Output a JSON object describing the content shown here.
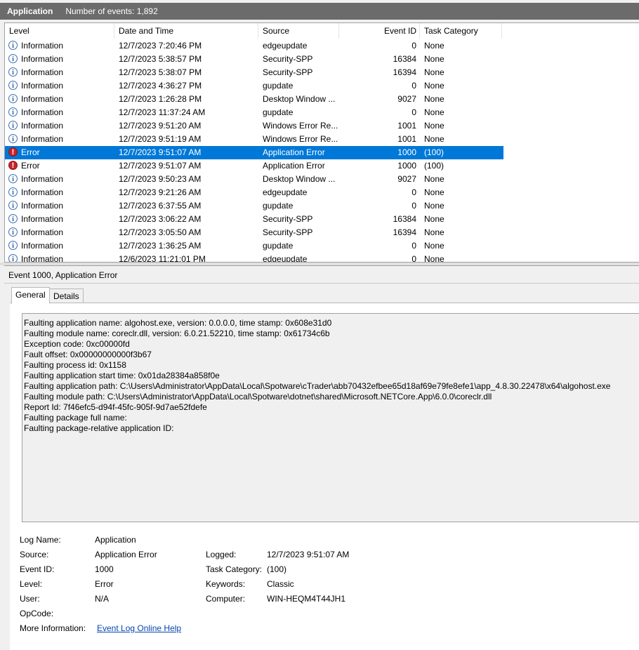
{
  "titlebar": {
    "log": "Application",
    "count": "Number of events: 1,892"
  },
  "columns": [
    "Level",
    "Date and Time",
    "Source",
    "Event ID",
    "Task Category"
  ],
  "events": [
    {
      "level": "Information",
      "icon": "info",
      "date": "12/7/2023 7:20:46 PM",
      "source": "edgeupdate",
      "id": "0",
      "cat": "None"
    },
    {
      "level": "Information",
      "icon": "info",
      "date": "12/7/2023 5:38:57 PM",
      "source": "Security-SPP",
      "id": "16384",
      "cat": "None"
    },
    {
      "level": "Information",
      "icon": "info",
      "date": "12/7/2023 5:38:07 PM",
      "source": "Security-SPP",
      "id": "16394",
      "cat": "None"
    },
    {
      "level": "Information",
      "icon": "info",
      "date": "12/7/2023 4:36:27 PM",
      "source": "gupdate",
      "id": "0",
      "cat": "None"
    },
    {
      "level": "Information",
      "icon": "info",
      "date": "12/7/2023 1:26:28 PM",
      "source": "Desktop Window ...",
      "id": "9027",
      "cat": "None"
    },
    {
      "level": "Information",
      "icon": "info",
      "date": "12/7/2023 11:37:24 AM",
      "source": "gupdate",
      "id": "0",
      "cat": "None"
    },
    {
      "level": "Information",
      "icon": "info",
      "date": "12/7/2023 9:51:20 AM",
      "source": "Windows Error Re...",
      "id": "1001",
      "cat": "None"
    },
    {
      "level": "Information",
      "icon": "info",
      "date": "12/7/2023 9:51:19 AM",
      "source": "Windows Error Re...",
      "id": "1001",
      "cat": "None"
    },
    {
      "level": "Error",
      "icon": "err",
      "date": "12/7/2023 9:51:07 AM",
      "source": "Application Error",
      "id": "1000",
      "cat": "(100)",
      "selected": true
    },
    {
      "level": "Error",
      "icon": "err",
      "date": "12/7/2023 9:51:07 AM",
      "source": "Application Error",
      "id": "1000",
      "cat": "(100)"
    },
    {
      "level": "Information",
      "icon": "info",
      "date": "12/7/2023 9:50:23 AM",
      "source": "Desktop Window ...",
      "id": "9027",
      "cat": "None"
    },
    {
      "level": "Information",
      "icon": "info",
      "date": "12/7/2023 9:21:26 AM",
      "source": "edgeupdate",
      "id": "0",
      "cat": "None"
    },
    {
      "level": "Information",
      "icon": "info",
      "date": "12/7/2023 6:37:55 AM",
      "source": "gupdate",
      "id": "0",
      "cat": "None"
    },
    {
      "level": "Information",
      "icon": "info",
      "date": "12/7/2023 3:06:22 AM",
      "source": "Security-SPP",
      "id": "16384",
      "cat": "None"
    },
    {
      "level": "Information",
      "icon": "info",
      "date": "12/7/2023 3:05:50 AM",
      "source": "Security-SPP",
      "id": "16394",
      "cat": "None"
    },
    {
      "level": "Information",
      "icon": "info",
      "date": "12/7/2023 1:36:25 AM",
      "source": "gupdate",
      "id": "0",
      "cat": "None"
    },
    {
      "level": "Information",
      "icon": "info",
      "date": "12/6/2023 11:21:01 PM",
      "source": "edgeupdate",
      "id": "0",
      "cat": "None"
    }
  ],
  "detail": {
    "title": "Event 1000, Application Error",
    "tabs": [
      "General",
      "Details"
    ],
    "description": [
      "Faulting application name: algohost.exe, version: 0.0.0.0, time stamp: 0x608e31d0",
      "Faulting module name: coreclr.dll, version: 6.0.21.52210, time stamp: 0x61734c6b",
      "Exception code: 0xc00000fd",
      "Fault offset: 0x00000000000f3b67",
      "Faulting process id: 0x1158",
      "Faulting application start time: 0x01da28384a858f0e",
      "Faulting application path: C:\\Users\\Administrator\\AppData\\Local\\Spotware\\cTrader\\abb70432efbee65d18af69e79fe8efe1\\app_4.8.30.22478\\x64\\algohost.exe",
      "Faulting module path: C:\\Users\\Administrator\\AppData\\Local\\Spotware\\dotnet\\shared\\Microsoft.NETCore.App\\6.0.0\\coreclr.dll",
      "Report Id: 7f46efc5-d94f-45fc-905f-9d7ae52fdefe",
      "Faulting package full name: ",
      "Faulting package-relative application ID: "
    ],
    "fields": {
      "log_name_label": "Log Name:",
      "log_name": "Application",
      "source_label": "Source:",
      "source": "Application Error",
      "logged_label": "Logged:",
      "logged": "12/7/2023 9:51:07 AM",
      "event_id_label": "Event ID:",
      "event_id": "1000",
      "task_label": "Task Category:",
      "task": "(100)",
      "level_label": "Level:",
      "level": "Error",
      "keywords_label": "Keywords:",
      "keywords": "Classic",
      "user_label": "User:",
      "user": "N/A",
      "computer_label": "Computer:",
      "computer": "WIN-HEQM4T44JH1",
      "opcode_label": "OpCode:",
      "more_label": "More Information:",
      "more_link": "Event Log Online Help"
    }
  }
}
